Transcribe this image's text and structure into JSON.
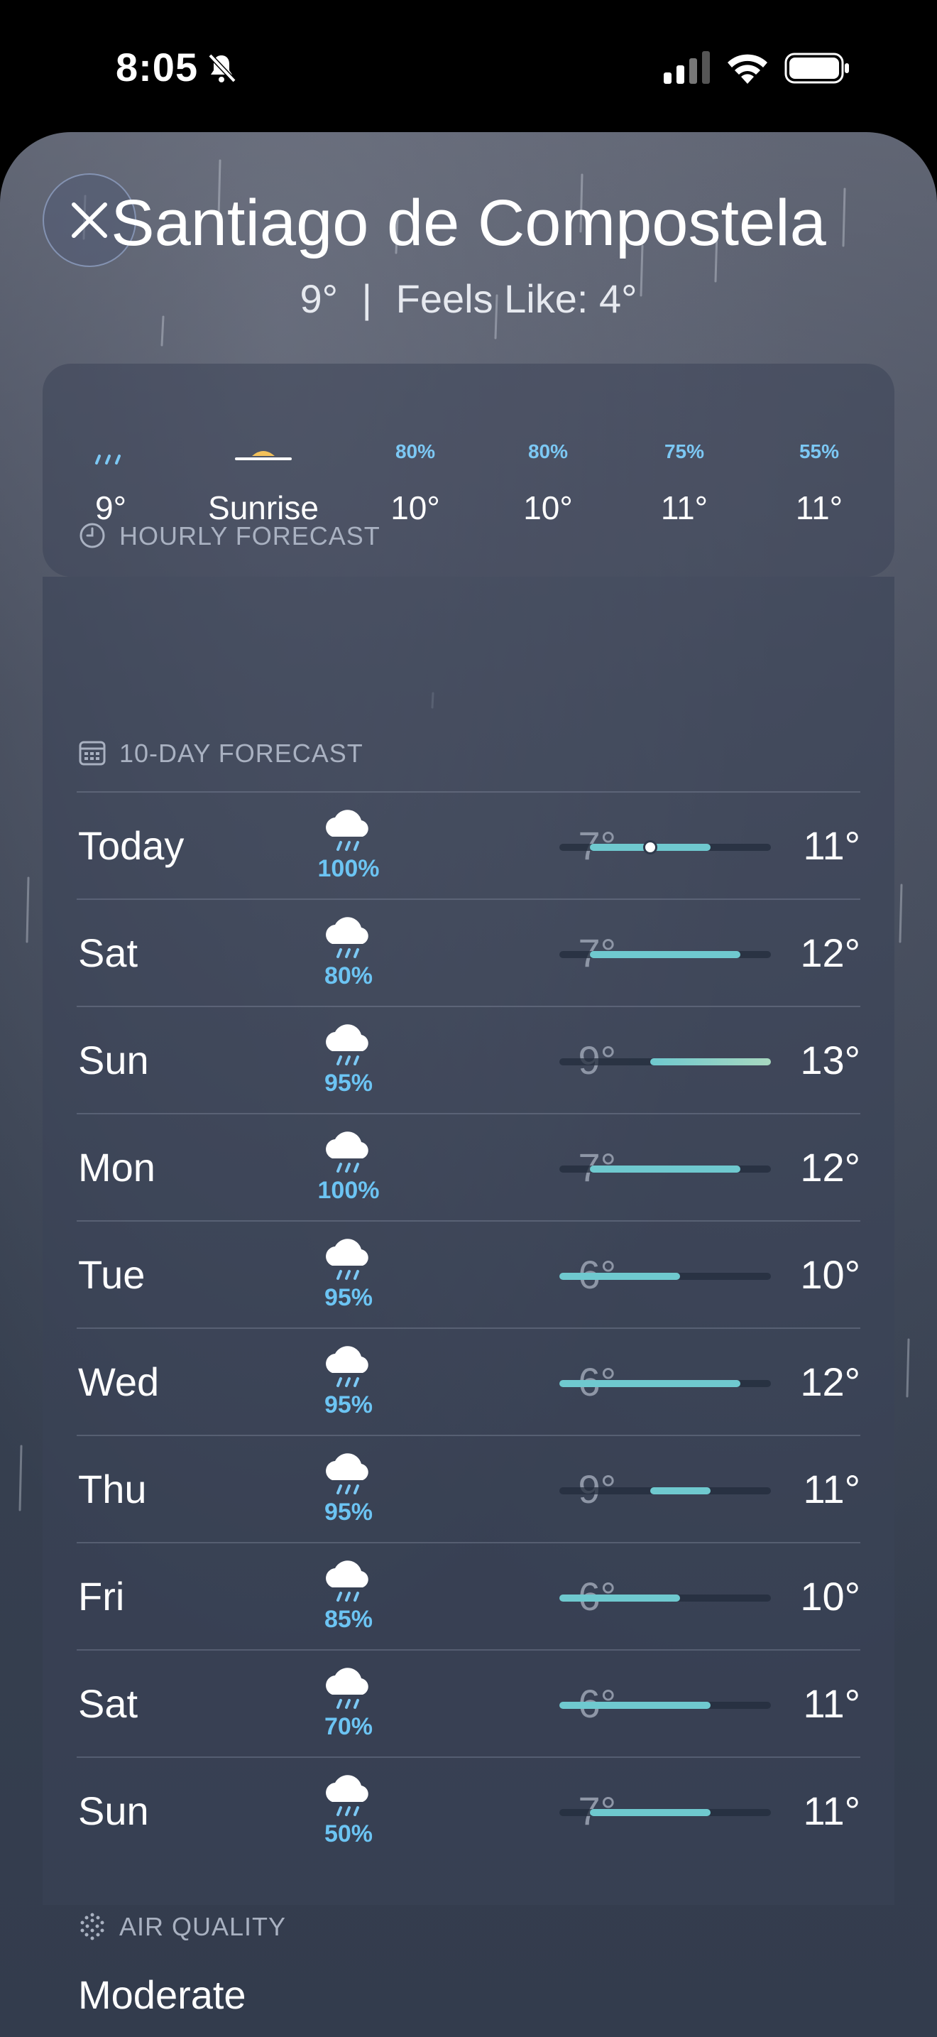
{
  "status_bar": {
    "time": "8:05"
  },
  "header": {
    "city": "Santiago de Compostela",
    "temp": "9°",
    "separator": "|",
    "feels_like": "Feels Like: 4°"
  },
  "hourly": {
    "title": "HOURLY FORECAST",
    "items": [
      {
        "icon": "rain-streaks-icon",
        "pct": "",
        "temp": "9°"
      },
      {
        "icon": "sunrise-icon",
        "pct": "",
        "temp": "Sunrise"
      },
      {
        "icon": "",
        "pct": "80%",
        "temp": "10°"
      },
      {
        "icon": "",
        "pct": "80%",
        "temp": "10°"
      },
      {
        "icon": "",
        "pct": "75%",
        "temp": "11°"
      },
      {
        "icon": "",
        "pct": "55%",
        "temp": "11°"
      }
    ]
  },
  "daily": {
    "title": "10-DAY FORECAST",
    "range_min": 6,
    "range_max": 13,
    "current_temp": 9,
    "days": [
      {
        "day": "Today",
        "pop": "100%",
        "low": "7°",
        "high": "11°",
        "low_val": 7,
        "high_val": 11
      },
      {
        "day": "Sat",
        "pop": "80%",
        "low": "7°",
        "high": "12°",
        "low_val": 7,
        "high_val": 12
      },
      {
        "day": "Sun",
        "pop": "95%",
        "low": "9°",
        "high": "13°",
        "low_val": 9,
        "high_val": 13
      },
      {
        "day": "Mon",
        "pop": "100%",
        "low": "7°",
        "high": "12°",
        "low_val": 7,
        "high_val": 12
      },
      {
        "day": "Tue",
        "pop": "95%",
        "low": "6°",
        "high": "10°",
        "low_val": 6,
        "high_val": 10
      },
      {
        "day": "Wed",
        "pop": "95%",
        "low": "6°",
        "high": "12°",
        "low_val": 6,
        "high_val": 12
      },
      {
        "day": "Thu",
        "pop": "95%",
        "low": "9°",
        "high": "11°",
        "low_val": 9,
        "high_val": 11
      },
      {
        "day": "Fri",
        "pop": "85%",
        "low": "6°",
        "high": "10°",
        "low_val": 6,
        "high_val": 10
      },
      {
        "day": "Sat",
        "pop": "70%",
        "low": "6°",
        "high": "11°",
        "low_val": 6,
        "high_val": 11
      },
      {
        "day": "Sun",
        "pop": "50%",
        "low": "7°",
        "high": "11°",
        "low_val": 7,
        "high_val": 11
      }
    ]
  },
  "air_quality": {
    "title": "AIR QUALITY",
    "value": "Moderate"
  },
  "colors": {
    "precip": "#6cc4f3",
    "bar_cool": "#6fc9cf",
    "bar_warm": "#a8d8c0"
  }
}
